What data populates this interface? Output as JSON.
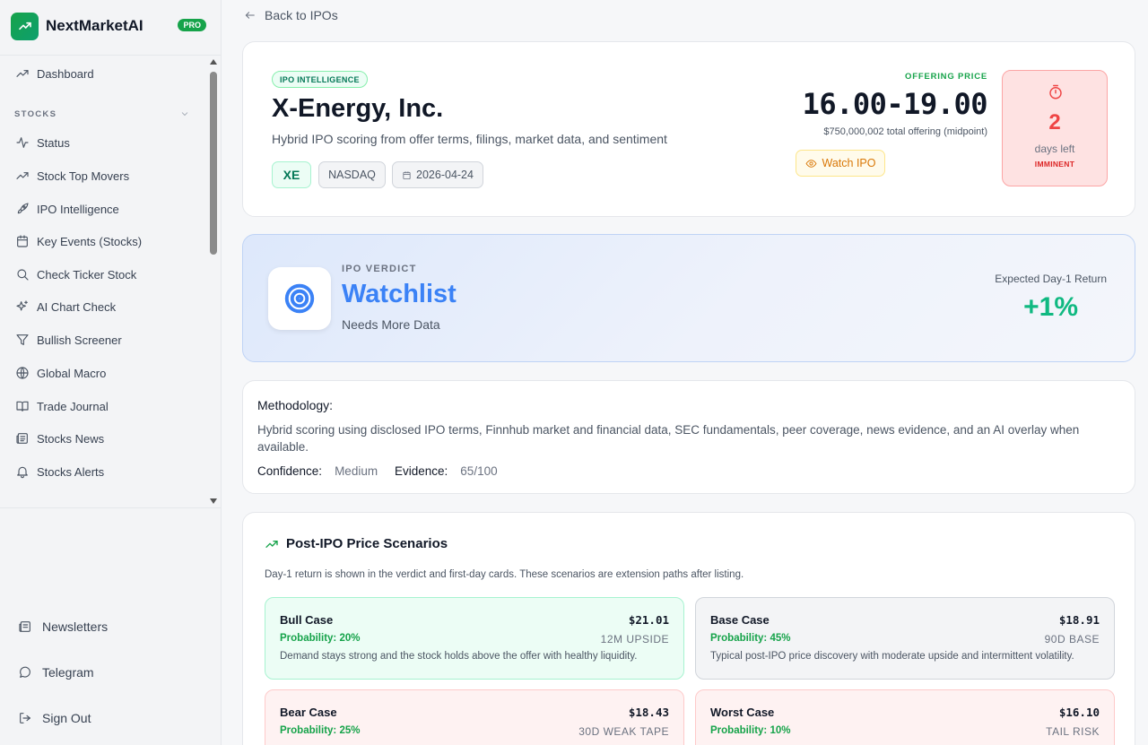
{
  "brand": {
    "name": "NextMarketAI",
    "badge": "PRO"
  },
  "sidebar": {
    "dashboard": "Dashboard",
    "section": "STOCKS",
    "items": [
      {
        "label": "Status",
        "icon": "activity-icon"
      },
      {
        "label": "Stock Top Movers",
        "icon": "trending-up-icon"
      },
      {
        "label": "IPO Intelligence",
        "icon": "rocket-icon"
      },
      {
        "label": "Key Events (Stocks)",
        "icon": "calendar-icon"
      },
      {
        "label": "Check Ticker Stock",
        "icon": "search-icon"
      },
      {
        "label": "AI Chart Check",
        "icon": "sparkles-icon"
      },
      {
        "label": "Bullish Screener",
        "icon": "filter-icon"
      },
      {
        "label": "Global Macro",
        "icon": "globe-icon"
      },
      {
        "label": "Trade Journal",
        "icon": "book-icon"
      },
      {
        "label": "Stocks News",
        "icon": "newspaper-icon"
      },
      {
        "label": "Stocks Alerts",
        "icon": "bell-icon"
      }
    ],
    "footer": {
      "newsletters": "Newsletters",
      "telegram": "Telegram",
      "signout": "Sign Out"
    }
  },
  "back": "Back to IPOs",
  "hero": {
    "chip": "IPO INTELLIGENCE",
    "company": "X-Energy, Inc.",
    "subtitle": "Hybrid IPO scoring from offer terms, filings, market data, and sentiment",
    "ticker": "XE",
    "exchange": "NASDAQ",
    "date": "2026-04-24",
    "offer_label": "OFFERING PRICE",
    "offer_price": "16.00-19.00",
    "offer_total": "$750,000,002 total offering (midpoint)",
    "watch": "Watch IPO",
    "countdown": {
      "value": "2",
      "label": "days left",
      "status": "IMMINENT"
    }
  },
  "verdict": {
    "kicker": "IPO VERDICT",
    "title": "Watchlist",
    "subtitle": "Needs More Data",
    "return_label": "Expected Day-1 Return",
    "return_value": "+1%"
  },
  "methodology": {
    "heading": "Methodology:",
    "body": "Hybrid scoring using disclosed IPO terms, Finnhub market and financial data, SEC fundamentals, peer coverage, news evidence, and an AI overlay when available.",
    "confidence_label": "Confidence:",
    "confidence": "Medium",
    "evidence_label": "Evidence:",
    "evidence": "65/100"
  },
  "scenarios": {
    "heading": "Post-IPO Price Scenarios",
    "note": "Day-1 return is shown in the verdict and first-day cards. These scenarios are extension paths after listing.",
    "bull": {
      "name": "Bull Case",
      "price": "$21.01",
      "prob": "Probability: 20%",
      "path": "12M UPSIDE",
      "desc": "Demand stays strong and the stock holds above the offer with healthy liquidity."
    },
    "base": {
      "name": "Base Case",
      "price": "$18.91",
      "prob": "Probability: 45%",
      "path": "90D BASE",
      "desc": "Typical post-IPO price discovery with moderate upside and intermittent volatility."
    },
    "bear": {
      "name": "Bear Case",
      "price": "$18.43",
      "prob": "Probability: 25%",
      "path": "30D WEAK TAPE",
      "desc": ""
    },
    "worst": {
      "name": "Worst Case",
      "price": "$16.10",
      "prob": "Probability: 10%",
      "path": "TAIL RISK",
      "desc": ""
    }
  },
  "colors": {
    "accent": "#16a34a",
    "verdict": "#3b82f6",
    "danger": "#ef4444",
    "warning": "#d97706"
  }
}
